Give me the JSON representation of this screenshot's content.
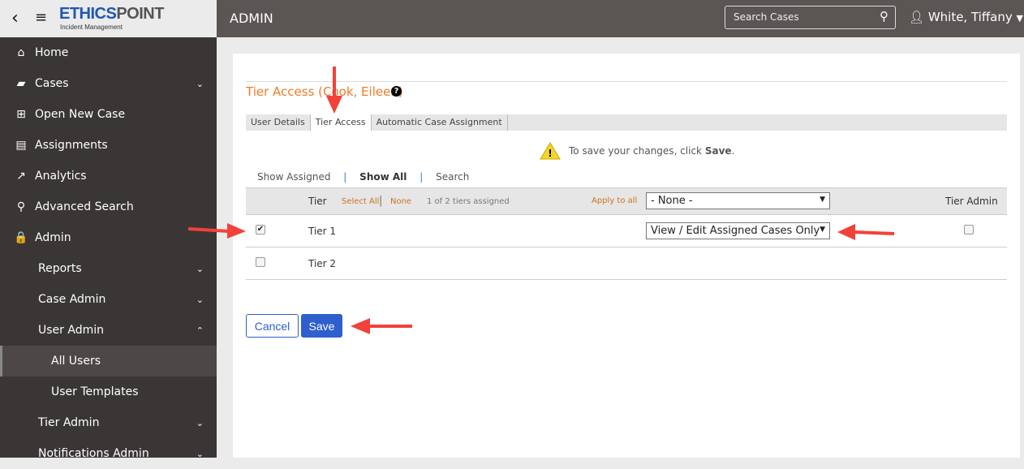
{
  "header": {
    "logo_a": "ETHICS",
    "logo_b": "POINT",
    "logo_sub": "Incident Management",
    "section": "ADMIN",
    "search_placeholder": "Search Cases",
    "user": "White, Tiffany"
  },
  "sidebar": {
    "items": [
      {
        "label": "Home",
        "icon": "⌂"
      },
      {
        "label": "Cases",
        "icon": "▰",
        "chev": "⌄"
      },
      {
        "label": "Open New Case",
        "icon": "⊞"
      },
      {
        "label": "Assignments",
        "icon": "▤"
      },
      {
        "label": "Analytics",
        "icon": "↗"
      },
      {
        "label": "Advanced Search",
        "icon": "⚲"
      },
      {
        "label": "Admin",
        "icon": "🔒"
      },
      {
        "label": "Reports",
        "chev": "⌄"
      },
      {
        "label": "Case Admin",
        "chev": "⌄"
      },
      {
        "label": "User Admin",
        "chev": "⌃"
      },
      {
        "label": "All Users"
      },
      {
        "label": "User Templates"
      },
      {
        "label": "Tier Admin",
        "chev": "⌄"
      },
      {
        "label": "Notifications Admin",
        "chev": "⌄"
      }
    ]
  },
  "main": {
    "title": "Tier Access (Cook, Eileen)",
    "help": "?",
    "tabs": [
      "User Details",
      "Tier Access",
      "Automatic Case Assignment"
    ],
    "notice_prefix": "To save your changes, click ",
    "notice_bold": "Save",
    ".": ".",
    "notice_suffix": ".",
    "filters": {
      "assigned": "Show Assigned",
      "sep": "|",
      "all": "Show All",
      "search": "Search"
    },
    "table": {
      "tier_header": "Tier",
      "select_all": "Select All",
      "sep": "|",
      "none": "None",
      "count": "1 of 2 tiers assigned",
      "apply_to_all": "Apply to all",
      "apply_value": "- None -",
      "admin_header": "Tier Admin",
      "rows": [
        {
          "name": "Tier 1",
          "checked": "✔",
          "access": "View / Edit Assigned Cases Only"
        },
        {
          "name": "Tier 2"
        }
      ]
    },
    "cancel": "Cancel",
    "save": "Save"
  }
}
